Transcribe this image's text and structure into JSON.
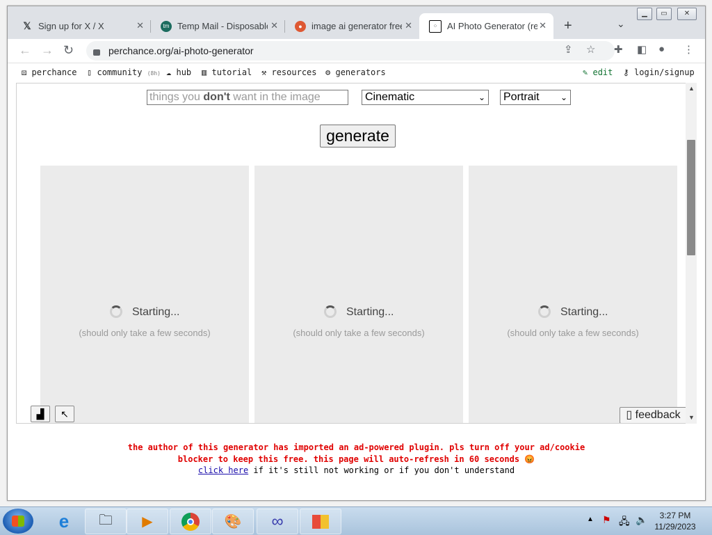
{
  "browser": {
    "tabs": [
      {
        "title": "Sign up for X / X",
        "icon": "x-logo-icon",
        "active": false
      },
      {
        "title": "Temp Mail - Disposable",
        "icon": "tempmail-icon",
        "active": false
      },
      {
        "title": "image ai generator free",
        "icon": "duckduckgo-icon",
        "active": false
      },
      {
        "title": "AI Photo Generator (rea",
        "icon": "perchance-dice-icon",
        "active": true
      }
    ],
    "url": "perchance.org/ai-photo-generator"
  },
  "nav": {
    "perchance": "perchance",
    "community": "community",
    "community_badge": "(8h)",
    "hub": "hub",
    "tutorial": "tutorial",
    "resources": "resources",
    "generators": "generators",
    "edit": "edit",
    "login": "login/signup"
  },
  "form": {
    "negative_prompt_placeholder_pre": "things you ",
    "negative_prompt_placeholder_bold": "don't",
    "negative_prompt_placeholder_post": " want in the image",
    "style_value": "Cinematic",
    "shape_value": "Portrait",
    "generate_label": "generate"
  },
  "cards": [
    {
      "status": "Starting...",
      "hint": "(should only take a few seconds)"
    },
    {
      "status": "Starting...",
      "hint": "(should only take a few seconds)"
    },
    {
      "status": "Starting...",
      "hint": "(should only take a few seconds)"
    }
  ],
  "feedback_label": "feedback",
  "notice": {
    "line1": "the author of this generator has imported an ad-powered plugin. pls turn off your ad/cookie",
    "line2": "blocker to keep this free. this page will auto-refresh in 60 seconds 😡",
    "link": "click here",
    "line3": " if it's still not working or if you don't understand"
  },
  "taskbar": {
    "time": "3:27 PM",
    "date": "11/29/2023"
  }
}
